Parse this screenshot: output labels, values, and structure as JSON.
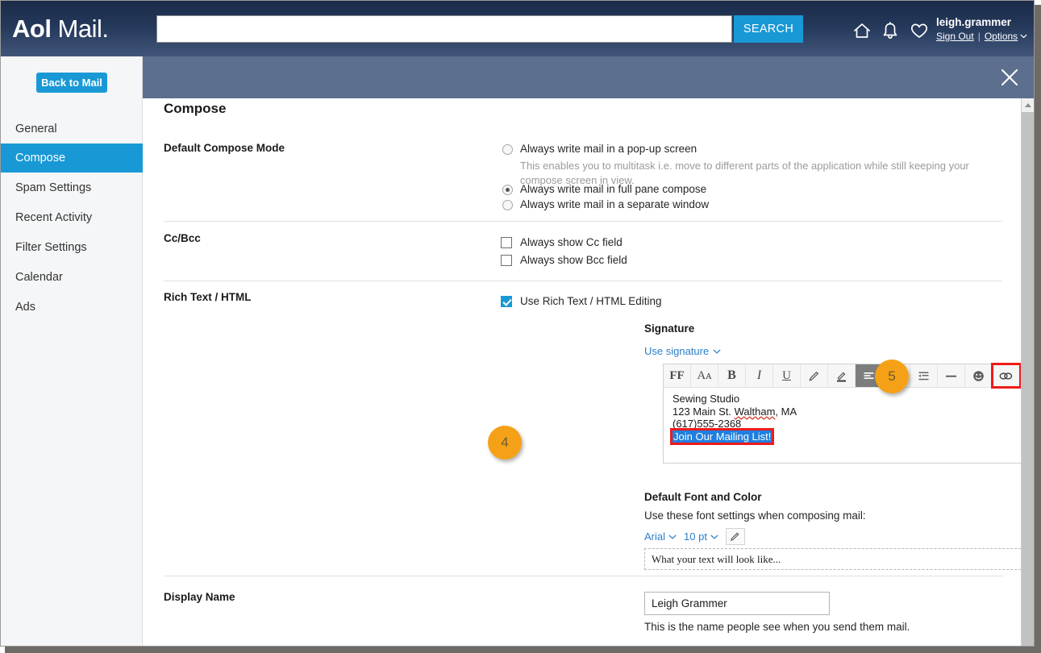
{
  "header": {
    "logo_bold": "Aol",
    "logo_light": " Mail.",
    "search_placeholder": "",
    "search_value": "",
    "search_button": "SEARCH",
    "icons": [
      "home-icon",
      "bell-icon",
      "heart-icon"
    ],
    "user_name": "leigh.grammer",
    "sign_out": "Sign Out",
    "separator": "|",
    "options": "Options"
  },
  "sidebar": {
    "back_to_mail": "Back to Mail",
    "items": [
      {
        "label": "General",
        "active": false
      },
      {
        "label": "Compose",
        "active": true
      },
      {
        "label": "Spam Settings",
        "active": false
      },
      {
        "label": "Recent Activity",
        "active": false
      },
      {
        "label": "Filter Settings",
        "active": false
      },
      {
        "label": "Calendar",
        "active": false
      },
      {
        "label": "Ads",
        "active": false
      }
    ]
  },
  "main": {
    "page_title": "Compose",
    "compose_mode": {
      "label": "Default Compose Mode",
      "options": [
        {
          "text": "Always write mail in a pop-up screen",
          "checked": false
        },
        {
          "text": "Always write mail in full pane compose",
          "checked": true
        },
        {
          "text": "Always write mail in a separate window",
          "checked": false
        }
      ],
      "help": "This enables you to multitask i.e. move to different parts of the application while still keeping your compose screen in view."
    },
    "ccbcc": {
      "label": "Cc/Bcc",
      "options": [
        {
          "text": "Always show Cc field",
          "checked": false
        },
        {
          "text": "Always show Bcc field",
          "checked": false
        }
      ]
    },
    "rich_text": {
      "label": "Rich Text / HTML",
      "option": {
        "text": "Use Rich Text / HTML Editing",
        "checked": true
      }
    },
    "signature": {
      "label": "Signature",
      "use_signature": "Use signature",
      "toolbar": [
        {
          "name": "font-family-button",
          "glyph": "FF",
          "style": "ff",
          "active": false,
          "highlighted": false
        },
        {
          "name": "font-size-button",
          "glyph": "Aᴀ",
          "style": "aa",
          "active": false,
          "highlighted": false
        },
        {
          "name": "bold-button",
          "glyph": "B",
          "style": "b",
          "active": false,
          "highlighted": false
        },
        {
          "name": "italic-button",
          "glyph": "I",
          "style": "i",
          "active": false,
          "highlighted": false
        },
        {
          "name": "underline-button",
          "glyph": "U",
          "style": "u",
          "active": false,
          "highlighted": false
        },
        {
          "name": "text-color-pencil-icon",
          "glyph": "",
          "style": "svg-pencil",
          "active": false,
          "highlighted": false
        },
        {
          "name": "highlight-color-icon",
          "glyph": "",
          "style": "svg-highlight",
          "active": false,
          "highlighted": false
        },
        {
          "name": "align-left-button",
          "glyph": "",
          "style": "svg-align",
          "active": true,
          "highlighted": false
        },
        {
          "name": "bulleted-list-button",
          "glyph": "",
          "style": "svg-list",
          "active": false,
          "highlighted": false
        },
        {
          "name": "indent-button",
          "glyph": "",
          "style": "svg-indent",
          "active": false,
          "highlighted": false
        },
        {
          "name": "horizontal-rule-button",
          "glyph": "",
          "style": "svg-hr",
          "active": false,
          "highlighted": false
        },
        {
          "name": "emoji-button",
          "glyph": "",
          "style": "svg-emoji",
          "active": false,
          "highlighted": false
        },
        {
          "name": "insert-link-button",
          "glyph": "",
          "style": "svg-link",
          "active": false,
          "highlighted": true
        }
      ],
      "content_lines": [
        "Sewing Studio",
        "123 Main St. Waltham, MA",
        "(617)555-2368"
      ],
      "city_misspelled": "Waltham",
      "line2_prefix": "123 Main St. ",
      "line2_suffix": ", MA",
      "selected_link_text": "Join Our Mailing List!"
    },
    "font_settings": {
      "label": "Default Font and Color",
      "help": "Use these font settings when composing mail:",
      "font_family": "Arial",
      "font_size": "10 pt",
      "color_icon": "pencil-icon",
      "preview": "What your text will look like..."
    },
    "display_name": {
      "label": "Display Name",
      "value": "Leigh Grammer",
      "help": "This is the name people see when you send them mail."
    }
  },
  "annotations": [
    {
      "number": "4",
      "target": "signature-link"
    },
    {
      "number": "5",
      "target": "insert-link-button"
    }
  ],
  "colors": {
    "accent_blue": "#1899d6",
    "header_dark": "#1b2c49",
    "slate_bar": "#5c6f8e",
    "badge_orange": "#f5a117",
    "highlight_red": "#ee1b1b",
    "selection_blue": "#1f7fe0"
  }
}
